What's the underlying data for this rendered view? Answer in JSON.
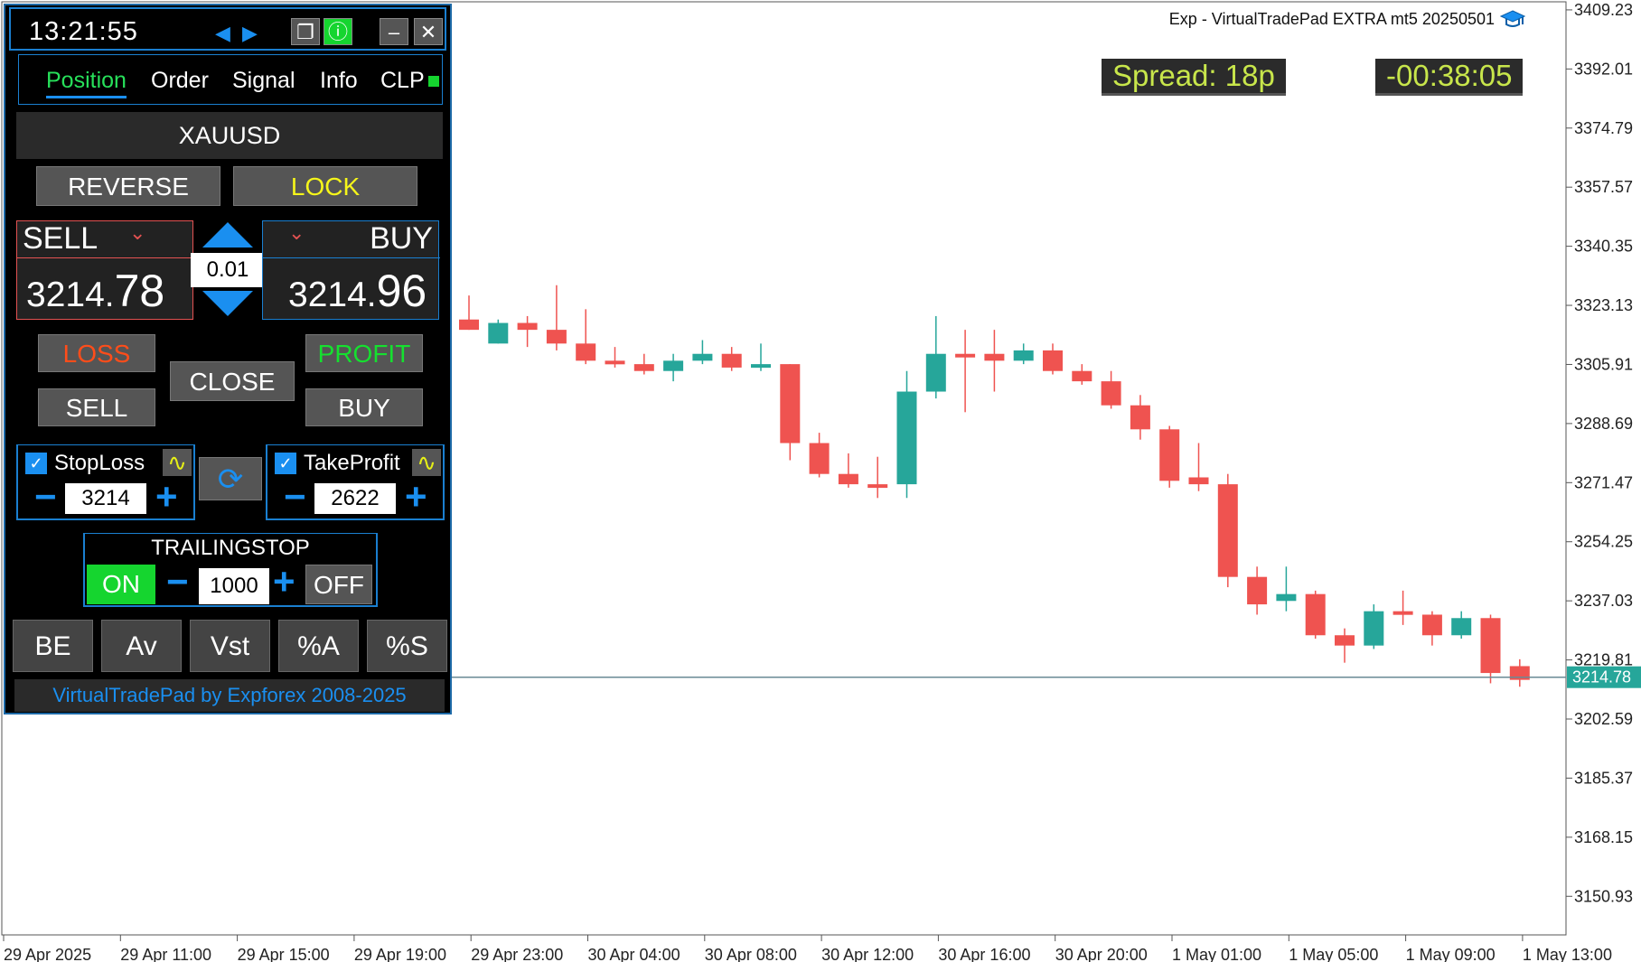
{
  "window": {
    "ea_title": "Exp - VirtualTradePad EXTRA mt5 20250501",
    "spread": "Spread: 18p",
    "timer": "-00:38:05"
  },
  "chart_data": {
    "type": "candlestick",
    "ylim": [
      3141.0,
      3410.0
    ],
    "y_ticks": [
      "3409.23",
      "3392.01",
      "3374.79",
      "3357.57",
      "3340.35",
      "3323.13",
      "3305.91",
      "3288.69",
      "3271.47",
      "3254.25",
      "3237.03",
      "3219.81",
      "3202.59",
      "3185.37",
      "3168.15",
      "3150.93"
    ],
    "x_ticks": [
      "29 Apr 2025",
      "29 Apr 11:00",
      "29 Apr 15:00",
      "29 Apr 19:00",
      "29 Apr 23:00",
      "30 Apr 04:00",
      "30 Apr 08:00",
      "30 Apr 12:00",
      "30 Apr 16:00",
      "30 Apr 20:00",
      "1 May 01:00",
      "1 May 05:00",
      "1 May 09:00",
      "1 May 13:00"
    ],
    "current_price": "3214.78",
    "candles": [
      {
        "o": 3319,
        "h": 3326,
        "l": 3316,
        "c": 3316
      },
      {
        "o": 3312,
        "h": 3319,
        "l": 3312,
        "c": 3318
      },
      {
        "o": 3318,
        "h": 3320,
        "l": 3311,
        "c": 3316
      },
      {
        "o": 3316,
        "h": 3329,
        "l": 3310,
        "c": 3312
      },
      {
        "o": 3312,
        "h": 3322,
        "l": 3306,
        "c": 3307
      },
      {
        "o": 3307,
        "h": 3311,
        "l": 3305,
        "c": 3306
      },
      {
        "o": 3306,
        "h": 3309,
        "l": 3303,
        "c": 3304
      },
      {
        "o": 3304,
        "h": 3309,
        "l": 3301,
        "c": 3307
      },
      {
        "o": 3307,
        "h": 3313,
        "l": 3306,
        "c": 3309
      },
      {
        "o": 3309,
        "h": 3311,
        "l": 3304,
        "c": 3305
      },
      {
        "o": 3305,
        "h": 3312,
        "l": 3304,
        "c": 3306
      },
      {
        "o": 3306,
        "h": 3306,
        "l": 3278,
        "c": 3283
      },
      {
        "o": 3283,
        "h": 3286,
        "l": 3273,
        "c": 3274
      },
      {
        "o": 3274,
        "h": 3280,
        "l": 3270,
        "c": 3271
      },
      {
        "o": 3271,
        "h": 3279,
        "l": 3267,
        "c": 3270
      },
      {
        "o": 3271,
        "h": 3304,
        "l": 3267,
        "c": 3298
      },
      {
        "o": 3298,
        "h": 3320,
        "l": 3296,
        "c": 3309
      },
      {
        "o": 3309,
        "h": 3316,
        "l": 3292,
        "c": 3308
      },
      {
        "o": 3309,
        "h": 3316,
        "l": 3298,
        "c": 3307
      },
      {
        "o": 3307,
        "h": 3312,
        "l": 3306,
        "c": 3310
      },
      {
        "o": 3310,
        "h": 3312,
        "l": 3303,
        "c": 3304
      },
      {
        "o": 3304,
        "h": 3306,
        "l": 3300,
        "c": 3301
      },
      {
        "o": 3301,
        "h": 3304,
        "l": 3293,
        "c": 3294
      },
      {
        "o": 3294,
        "h": 3297,
        "l": 3284,
        "c": 3287
      },
      {
        "o": 3287,
        "h": 3288,
        "l": 3270,
        "c": 3272
      },
      {
        "o": 3273,
        "h": 3283,
        "l": 3269,
        "c": 3271
      },
      {
        "o": 3271,
        "h": 3274,
        "l": 3241,
        "c": 3244
      },
      {
        "o": 3244,
        "h": 3247,
        "l": 3233,
        "c": 3236
      },
      {
        "o": 3237,
        "h": 3247,
        "l": 3234,
        "c": 3239
      },
      {
        "o": 3239,
        "h": 3240,
        "l": 3226,
        "c": 3227
      },
      {
        "o": 3227,
        "h": 3229,
        "l": 3219,
        "c": 3224
      },
      {
        "o": 3224,
        "h": 3236,
        "l": 3223,
        "c": 3234
      },
      {
        "o": 3234,
        "h": 3240,
        "l": 3230,
        "c": 3233
      },
      {
        "o": 3233,
        "h": 3234,
        "l": 3224,
        "c": 3227
      },
      {
        "o": 3227,
        "h": 3234,
        "l": 3226,
        "c": 3232
      },
      {
        "o": 3232,
        "h": 3233,
        "l": 3213,
        "c": 3216
      },
      {
        "o": 3218,
        "h": 3220,
        "l": 3212,
        "c": 3214
      }
    ]
  },
  "panel": {
    "clock": "13:21:55",
    "tabs": [
      "Position",
      "Order",
      "Signal",
      "Info",
      "CLP"
    ],
    "symbol": "XAUUSD",
    "reverse_label": "REVERSE",
    "lock_label": "LOCK",
    "sell_title": "SELL",
    "buy_title": "BUY",
    "sell_price_main": "3214.",
    "sell_price_big": "78",
    "buy_price_main": "3214.",
    "buy_price_big": "96",
    "lot": "0.01",
    "loss_label": "LOSS",
    "profit_label": "PROFIT",
    "close_label": "CLOSE",
    "sell_btn": "SELL",
    "buy_btn": "BUY",
    "stoploss_label": "StopLoss",
    "stoploss_value": "3214",
    "takeprofit_label": "TakeProfit",
    "takeprofit_value": "2622",
    "trailing_label": "TRAILINGSTOP",
    "trailing_on": "ON",
    "trailing_value": "1000",
    "trailing_off": "OFF",
    "bottom_buttons": [
      "BE",
      "Av",
      "Vst",
      "%A",
      "%S"
    ],
    "footer": "VirtualTradePad by Expforex 2008-2025",
    "colors": {
      "bull": "#26a69a",
      "bear": "#ef5350",
      "accent": "#1a8ff0",
      "green": "#15d52f",
      "lock": "#f5f51a",
      "loss": "#ff4d1a"
    }
  }
}
